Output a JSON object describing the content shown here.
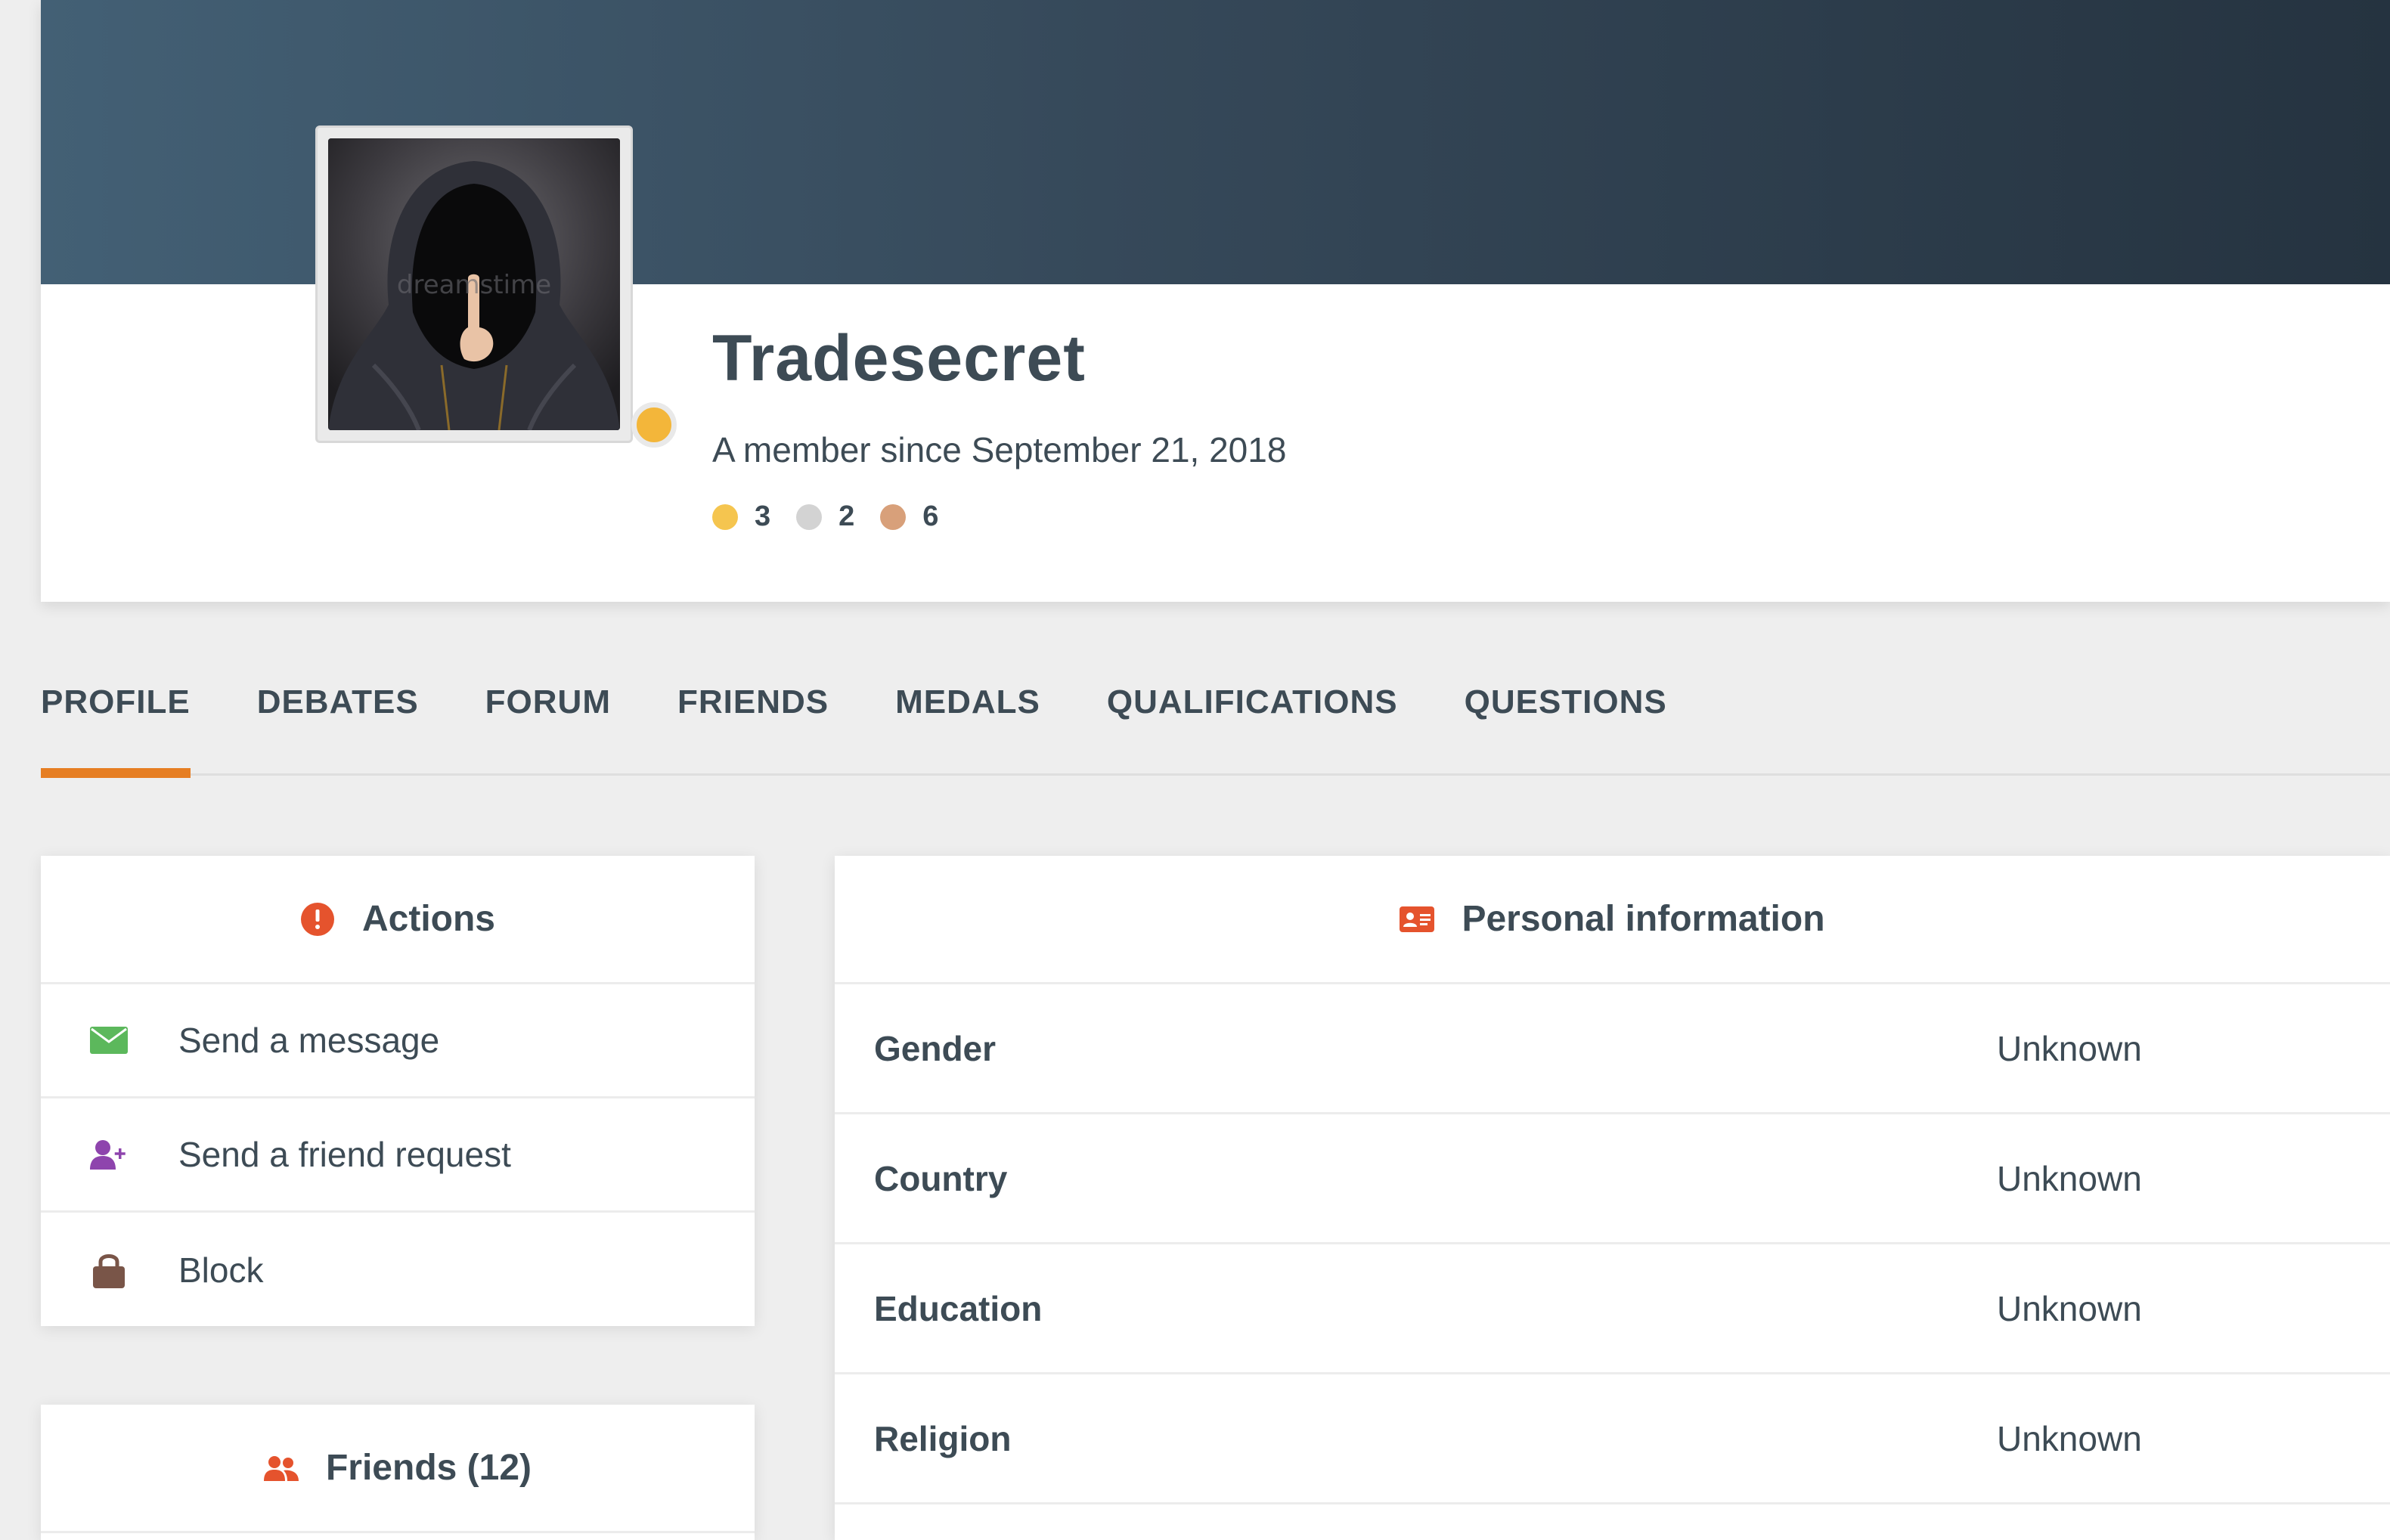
{
  "profile": {
    "username": "Tradesecret",
    "member_since": "A member since September 21, 2018",
    "status_color": "#f3b63a",
    "medals": [
      {
        "type": "gold",
        "color": "#f5c54f",
        "count": "3"
      },
      {
        "type": "silver",
        "color": "#d3d3d3",
        "count": "2"
      },
      {
        "type": "bronze",
        "color": "#d8a07a",
        "count": "6"
      }
    ],
    "avatar_watermark": "dreamstime"
  },
  "tabs": [
    {
      "label": "PROFILE",
      "active": true
    },
    {
      "label": "DEBATES",
      "active": false
    },
    {
      "label": "FORUM",
      "active": false
    },
    {
      "label": "FRIENDS",
      "active": false
    },
    {
      "label": "MEDALS",
      "active": false
    },
    {
      "label": "QUALIFICATIONS",
      "active": false
    },
    {
      "label": "QUESTIONS",
      "active": false
    }
  ],
  "actions": {
    "title": "Actions",
    "icon": "alert-circle-icon",
    "items": [
      {
        "label": "Send a message",
        "icon": "envelope-icon",
        "color": "#5cb85c"
      },
      {
        "label": "Send a friend request",
        "icon": "user-plus-icon",
        "color": "#8e44ad"
      },
      {
        "label": "Block",
        "icon": "lock-icon",
        "color": "#795548"
      }
    ]
  },
  "friends": {
    "title": "Friends (12)",
    "icon": "users-icon"
  },
  "personal_info": {
    "title": "Personal information",
    "icon": "id-card-icon",
    "rows": [
      {
        "label": "Gender",
        "value": "Unknown"
      },
      {
        "label": "Country",
        "value": "Unknown"
      },
      {
        "label": "Education",
        "value": "Unknown"
      },
      {
        "label": "Religion",
        "value": "Unknown"
      }
    ]
  },
  "colors": {
    "accent": "#e67e22",
    "icon_orange": "#e5532d",
    "text": "#3d4b55"
  }
}
